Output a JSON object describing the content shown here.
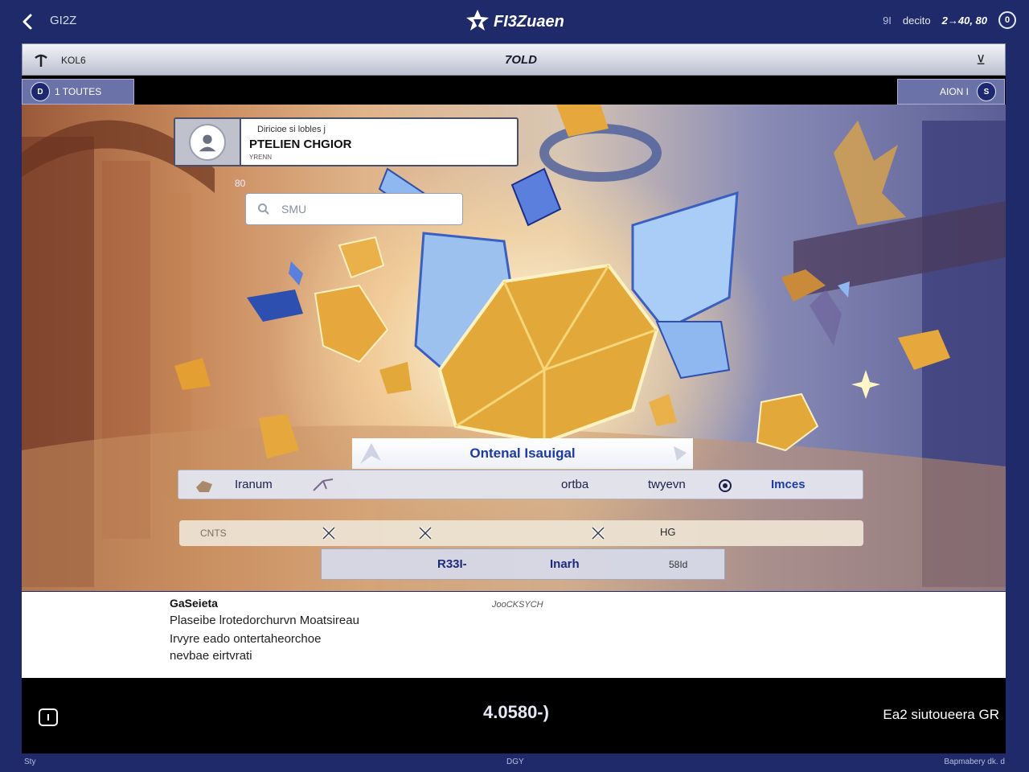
{
  "topbar": {
    "back_label": "GI2Z",
    "brand_name": "FI3Zuaen",
    "stat_left": "9I",
    "stat_mid": "decito",
    "wallet": "2→40, 80",
    "info_button": "0"
  },
  "header": {
    "left_label": "KOL6",
    "title": "7OLD",
    "menu_glyph": "⊻"
  },
  "badges": {
    "left_dot": "D",
    "left_label": "1 TOUTES",
    "right_label": "AION I",
    "right_dot": "S"
  },
  "player_card": {
    "subtitle": "Diricioe si lobles j",
    "name": "PTELIEN CHGIOR",
    "tag": "YRENN"
  },
  "level_tag": "80",
  "search": {
    "placeholder": "SMU"
  },
  "reward": {
    "title": "Ontenal Isauigal"
  },
  "stats": {
    "item1": "Iranum",
    "item2": "ortba",
    "item3": "twyevn",
    "item4": "Imces"
  },
  "filter": {
    "label": "CNTS",
    "value": "HG"
  },
  "result": {
    "left": "R33I-",
    "mid": "Inarh",
    "right": "58Id"
  },
  "description": {
    "title": "GaSeieta",
    "meta": "JooCKSYCH",
    "lines": [
      "Plaseibe lrotedorchurvn Moatsireau",
      "Irvyre eado ontertaheorchoe",
      "nevbae eirtvrati"
    ]
  },
  "bottom": {
    "counter": "4.0580-)",
    "action": "Ea2 siutoueera GR"
  },
  "footer": {
    "left": "Sty",
    "center": "DGY",
    "right": "Bapmabery dk. d"
  },
  "colors": {
    "background": "#1f2a6b",
    "accent_blue": "#1c3ba6",
    "gold": "#e3a83a",
    "crystal": "#8fb8f0"
  },
  "icons": [
    "chevron-left-icon",
    "star-logo-icon",
    "info-icon",
    "pickaxe-icon",
    "menu-icon",
    "avatar-icon",
    "search-icon",
    "x-icon",
    "screen-icon"
  ]
}
